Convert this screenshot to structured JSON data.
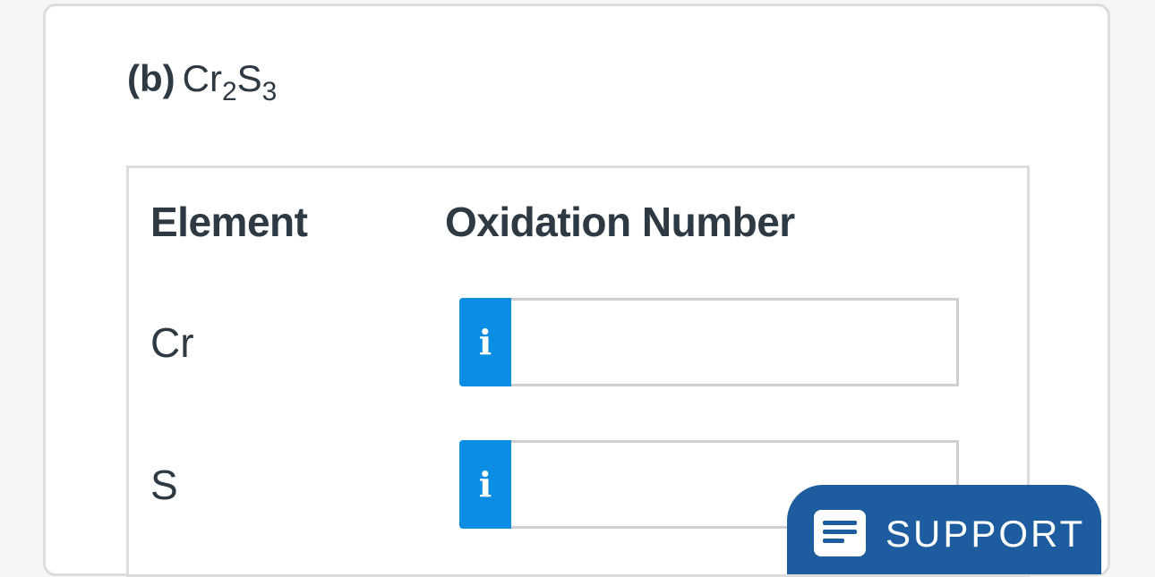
{
  "question": {
    "part_label": "(b)",
    "formula": {
      "el1": "Cr",
      "sub1": "2",
      "el2": "S",
      "sub2": "3"
    }
  },
  "table": {
    "headers": {
      "element": "Element",
      "oxidation": "Oxidation Number"
    },
    "rows": [
      {
        "element": "Cr",
        "info_glyph": "i",
        "value": ""
      },
      {
        "element": "S",
        "info_glyph": "i",
        "value": ""
      }
    ]
  },
  "support": {
    "label": "SUPPORT",
    "icon": "chat-lines-icon"
  },
  "colors": {
    "info_button": "#0b8de4",
    "support_button": "#1d5c9e",
    "text": "#2d3a44",
    "border": "#dcdcdc"
  }
}
